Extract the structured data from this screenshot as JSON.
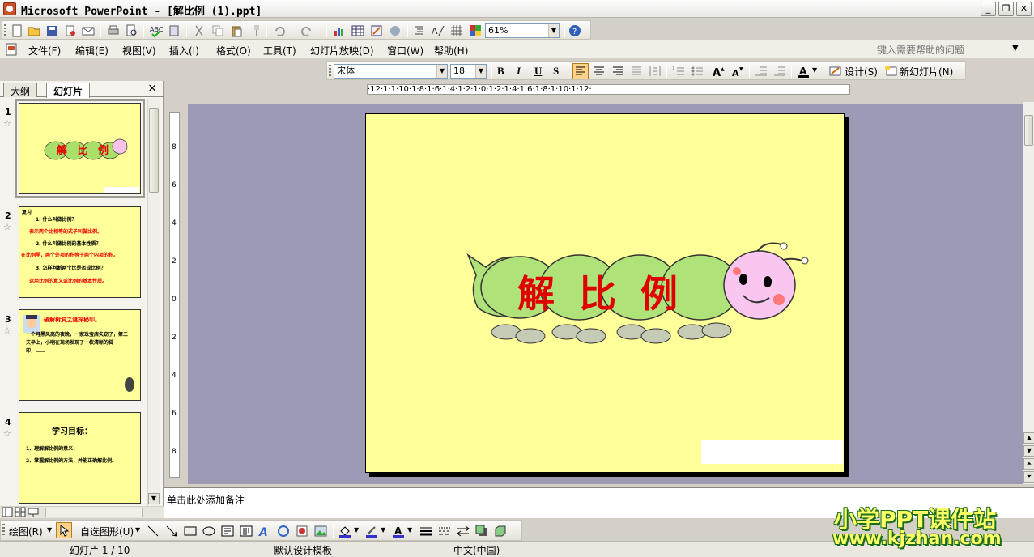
{
  "window": {
    "title": "Microsoft PowerPoint - [解比例 (1).ppt]",
    "minimize": "_",
    "restore": "❐",
    "close": "✕"
  },
  "standard_toolbar": {
    "zoom": "61%"
  },
  "menu": {
    "items": [
      "文件(F)",
      "编辑(E)",
      "视图(V)",
      "插入(I)",
      "格式(O)",
      "工具(T)",
      "幻灯片放映(D)",
      "窗口(W)",
      "帮助(H)"
    ],
    "help_placeholder": "键入需要帮助的问题"
  },
  "format_toolbar": {
    "font": "宋体",
    "size": "18",
    "bold": "B",
    "italic": "I",
    "underline": "U",
    "shadow": "S",
    "design": "设计(S)",
    "new_slide": "新幻灯片(N)"
  },
  "left_pane": {
    "tabs": [
      "大纲",
      "幻灯片"
    ],
    "close": "×",
    "slides": [
      {
        "num": "1",
        "title": "解 比 例"
      },
      {
        "num": "2",
        "lines": [
          "复习",
          "1. 什么叫做比例？",
          "表示两个比相等的式子叫做比例。",
          "2. 什么叫做比例的基本性质？",
          "在比例里，两个外项的积等于两个内项的积。",
          "3. 怎样判断两个比是否成比例？",
          "运用比例的意义或比例的基本性质。"
        ]
      },
      {
        "num": "3",
        "title": "破解树洞之谜探秘印。",
        "lines": [
          "一个月黑风高的夜晚，一家珠宝店失窃了，第二天早上，小明在现场发现了一枚清晰的脚印，……"
        ]
      },
      {
        "num": "4",
        "title": "学习目标：",
        "lines": [
          "1、理解解比例的意义；",
          "2、掌握解比例的方法，并能正确解比例。"
        ]
      }
    ]
  },
  "slide": {
    "title": "解比例"
  },
  "ruler": {
    "h": "·12·1·1·10·1·8·1·6·1·4·1·2·1·0·1·2·1·4·1·6·1·8·1·10·1·12·"
  },
  "notes": {
    "placeholder": "单击此处添加备注"
  },
  "draw_toolbar": {
    "draw": "绘图(R)",
    "autoshapes": "自选图形(U)"
  },
  "status": {
    "slide": "幻灯片 1 / 10",
    "template": "默认设计模板",
    "language": "中文(中国)"
  },
  "watermark": {
    "line1": "小学PPT课件站",
    "line2": "www.kjzhan.com"
  }
}
